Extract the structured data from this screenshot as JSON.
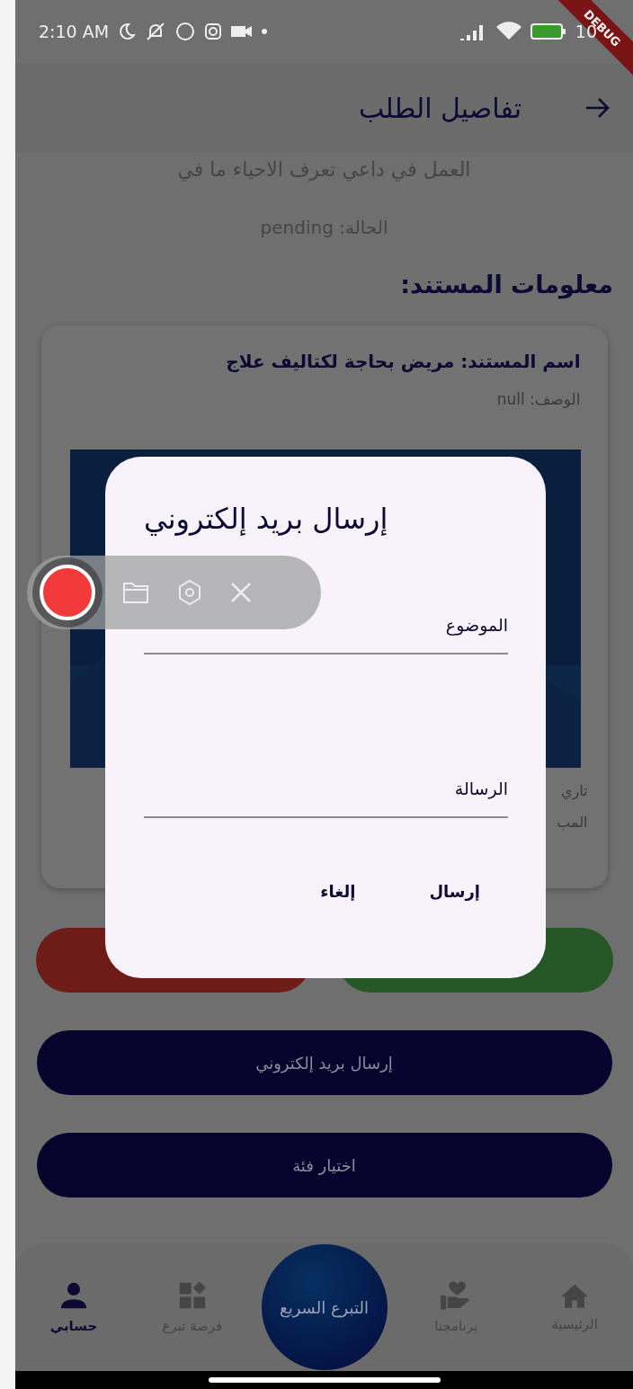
{
  "status_bar": {
    "time": "2:10 AM",
    "battery": "10"
  },
  "debug_banner": "DEBUG",
  "app_bar": {
    "title": "تفاصيل الطلب"
  },
  "request": {
    "description": "العمل في داعي تعرف الاحياء ما في",
    "status": "الحالة: pending"
  },
  "document_section": {
    "heading": "معلومات المستند:",
    "name": "اسم المستند: مريض بحاجة لكتاليف علاج",
    "description": "الوصف: null",
    "date": "تاري",
    "amount": "المب"
  },
  "action_buttons": [
    {
      "kind": "accept"
    },
    {
      "kind": "reject"
    }
  ],
  "wide_buttons": [
    "إرسال بريد إلكتروني",
    "اختيار فئة"
  ],
  "bottom_nav": {
    "items": [
      {
        "label": "الرئيسية",
        "kind": "home",
        "selected": false
      },
      {
        "label": "برنامجنا",
        "kind": "programs",
        "selected": false
      },
      {
        "label": "فرصة تبرع",
        "kind": "opportunity",
        "selected": false
      },
      {
        "label": "حسابي",
        "kind": "account",
        "selected": true
      }
    ],
    "center_button": "التبرع السريع"
  },
  "dialog": {
    "title": "إرسال بريد إلكتروني",
    "fields": [
      {
        "label": "الموضوع"
      },
      {
        "label": "الرسالة"
      }
    ],
    "buttons": [
      "إرسال",
      "إلغاء"
    ]
  }
}
